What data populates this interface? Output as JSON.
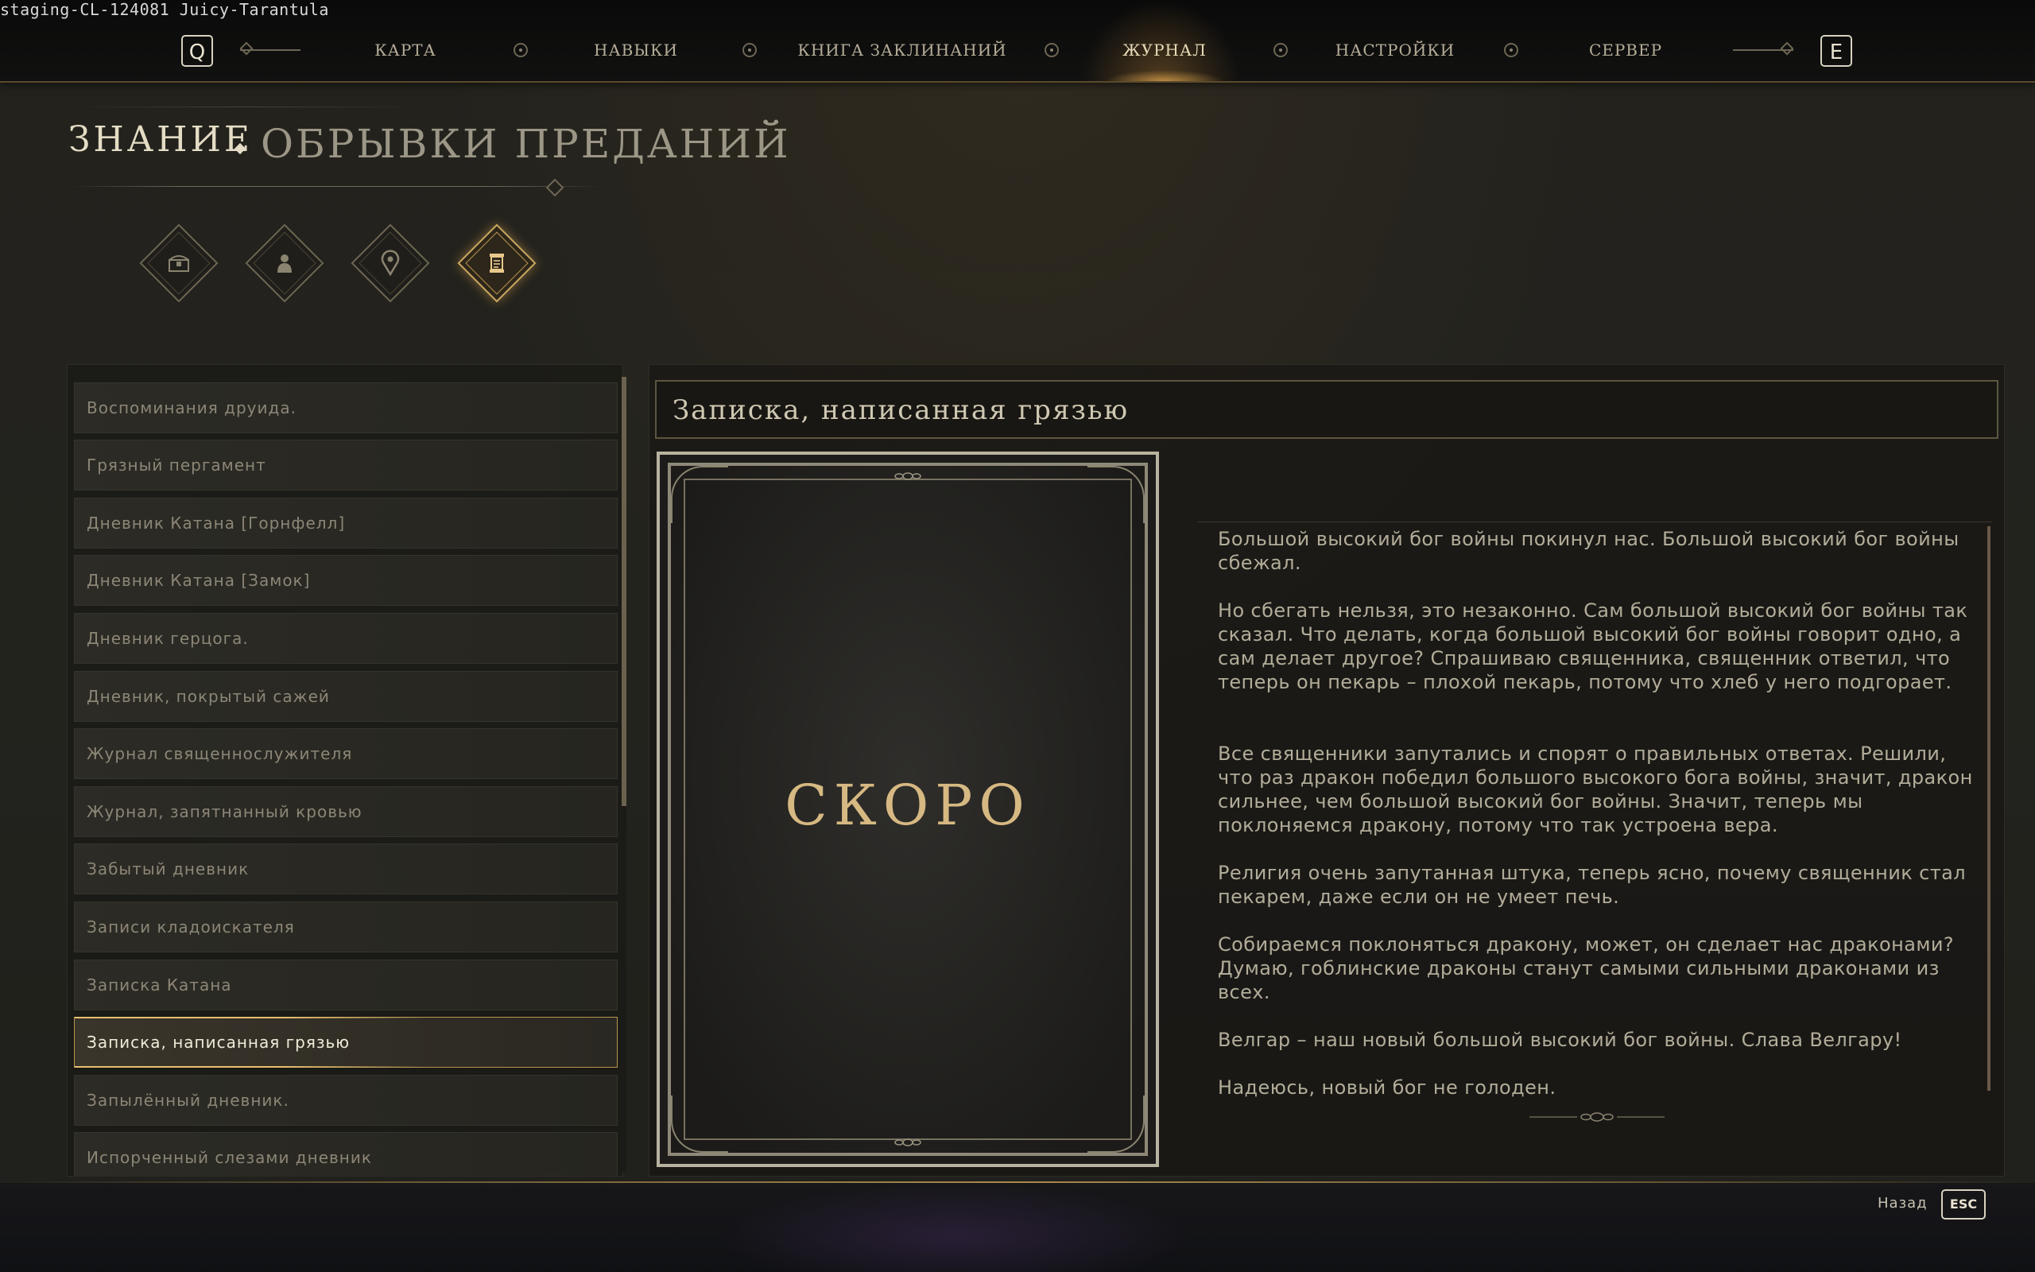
{
  "build_tag": "staging-CL-124081 Juicy-Tarantula",
  "nav": {
    "left_key": "Q",
    "right_key": "E",
    "items": [
      {
        "label": "КАРТА",
        "active": false
      },
      {
        "label": "НАВЫКИ",
        "active": false
      },
      {
        "label": "КНИГА ЗАКЛИНАНИЙ",
        "active": false
      },
      {
        "label": "ЖУРНАЛ",
        "active": true
      },
      {
        "label": "НАСТРОЙКИ",
        "active": false
      },
      {
        "label": "СЕРВЕР",
        "active": false
      }
    ]
  },
  "heading": {
    "main": "ЗНАНИЕ",
    "sub": "ОБРЫВКИ ПРЕДАНИЙ"
  },
  "categories": [
    {
      "icon": "chest-icon",
      "active": false
    },
    {
      "icon": "person-icon",
      "active": false
    },
    {
      "icon": "location-pin-icon",
      "active": false
    },
    {
      "icon": "scroll-icon",
      "active": true
    }
  ],
  "lore_list": {
    "selected_index": 11,
    "items": [
      "Воспоминания друида.",
      "Грязный пергамент",
      "Дневник Катана [Горнфелл]",
      "Дневник Катана [Замок]",
      "Дневник герцога.",
      "Дневник, покрытый сажей",
      "Журнал священнослужителя",
      "Журнал, запятнанный кровью",
      "Забытый дневник",
      "Записи кладоискателя",
      "Записка Катана",
      "Записка, написанная грязью",
      "Запылённый дневник.",
      "Испорченный слезами дневник"
    ]
  },
  "detail": {
    "title": "Записка, написанная грязью",
    "book_placeholder": "СКОРО",
    "paragraphs": [
      "Большой высокий бог войны покинул нас. Большой высокий бог войны сбежал.",
      "Но сбегать нельзя, это незаконно. Сам большой высокий бог войны так сказал. Что делать, когда большой высокий бог войны говорит одно, а сам делает другое? Спрашиваю священника, священник ответил, что теперь он пекарь – плохой пекарь, потому что хлеб у него подгорает.",
      "Все священники запутались и спорят о правильных ответах. Решили, что раз дракон победил большого высокого бога войны, значит, дракон сильнее, чем большой высокий бог войны. Значит, теперь мы поклоняемся дракону, потому что так устроена вера.",
      "Религия очень запутанная штука, теперь ясно, почему священник стал пекарем, даже если он не умеет печь.",
      "Собираемся поклоняться дракону, может, он сделает нас драконами? Думаю, гоблинские драконы станут самыми сильными драконами из всех.",
      "Велгар – наш новый большой высокий бог войны. Слава Велгару!",
      "Надеюсь, новый бог не голоден."
    ]
  },
  "footer": {
    "back_label": "Назад",
    "back_key": "ESC"
  }
}
